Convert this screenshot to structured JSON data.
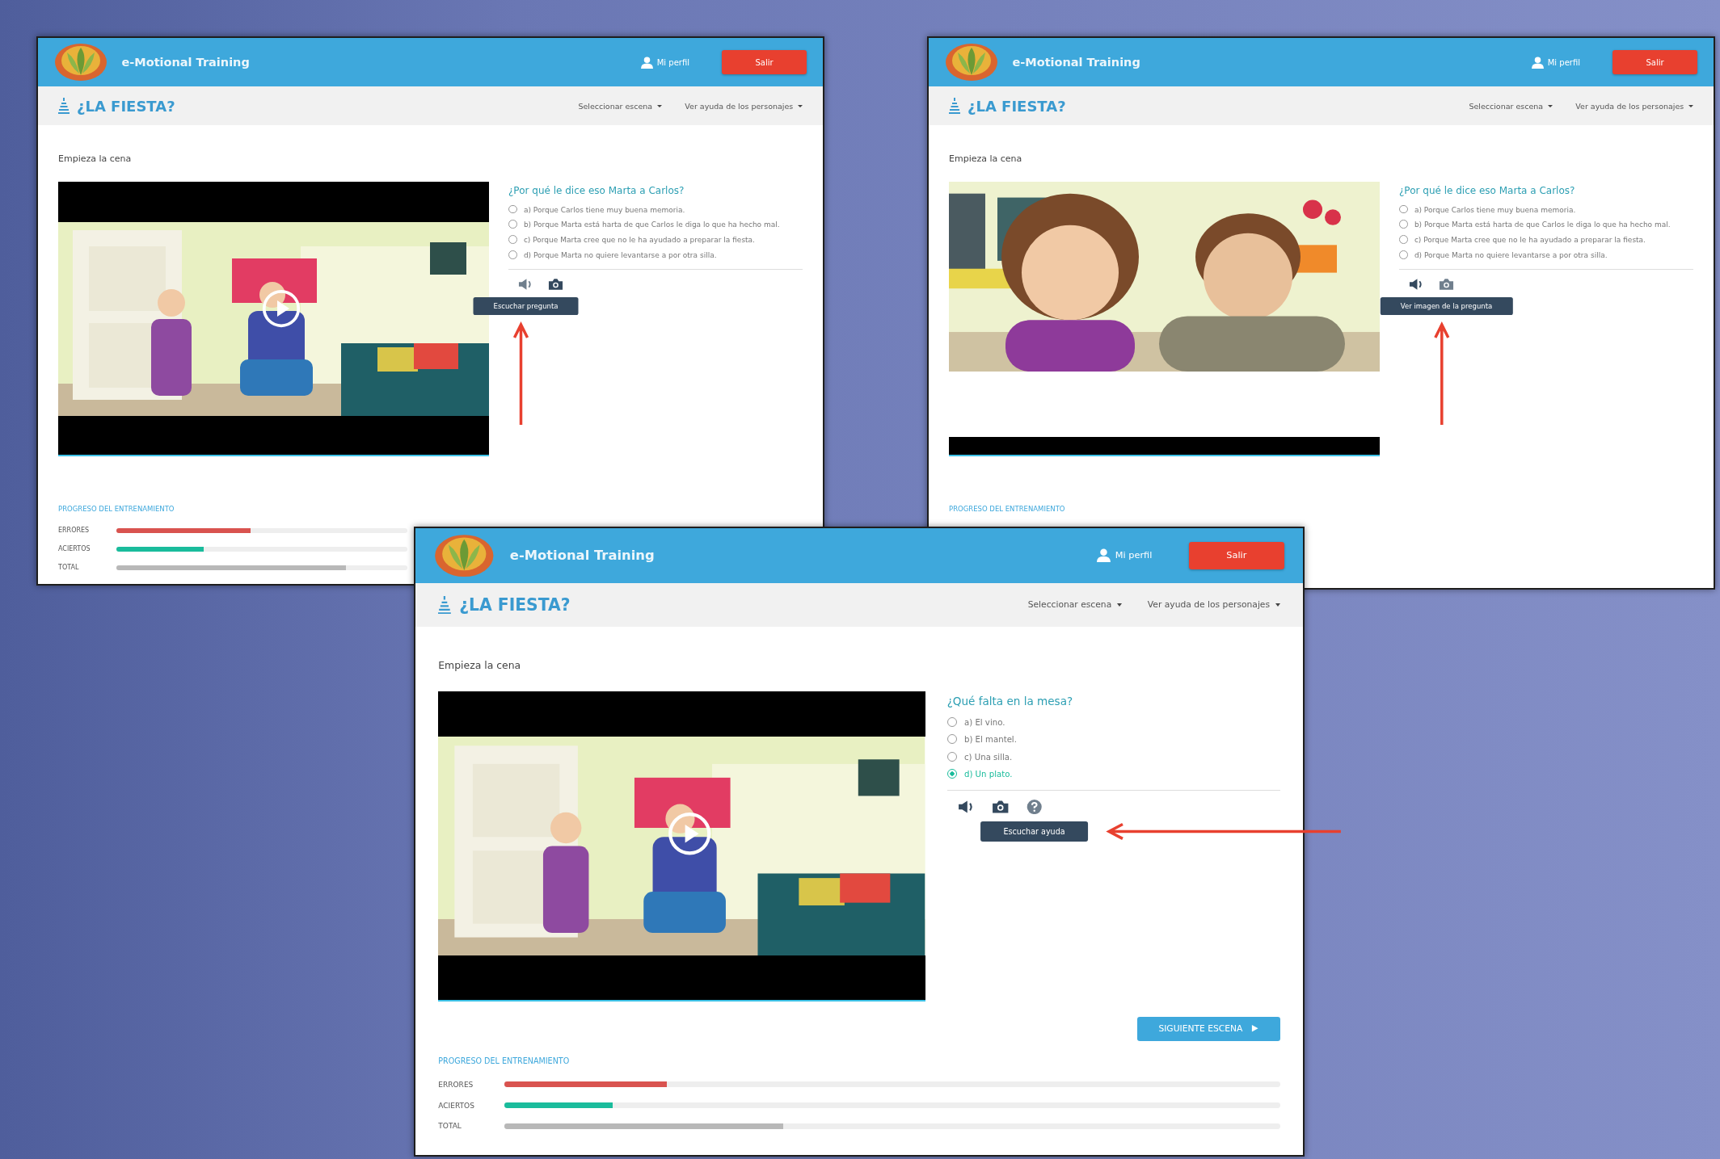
{
  "windows": [
    {
      "header": {
        "title": "e-Motional Training",
        "profile": "Mi perfil",
        "logout": "Salir"
      },
      "toolbar": {
        "title": "¿LA FIESTA?",
        "menus": [
          "Seleccionar escena",
          "Ver ayuda de los personajes"
        ]
      },
      "scene": "Empieza la cena",
      "video": {
        "kind": "letterbox",
        "play": true
      },
      "question": {
        "title": "¿Por qué le dice eso Marta a Carlos?",
        "options": [
          {
            "label": "a) Porque Carlos tiene muy buena memoria.",
            "selected": false
          },
          {
            "label": "b) Porque Marta está harta de que Carlos le diga lo que ha hecho mal.",
            "selected": false
          },
          {
            "label": "c) Porque Marta cree que no le ha ayudado a preparar la fiesta.",
            "selected": false
          },
          {
            "label": "d) Porque Marta no quiere levantarse a por otra silla.",
            "selected": false
          }
        ]
      },
      "tools": [
        {
          "kind": "speaker",
          "hovered": true
        },
        {
          "kind": "camera",
          "hovered": false
        }
      ],
      "tooltip": "Escuchar pregunta",
      "arrow": {
        "kind": "up"
      },
      "progress": {
        "title": "PROGRESO DEL ENTRENAMIENTO",
        "rows": [
          {
            "label": "ERRORES",
            "kind": "errors",
            "level": 0.46
          },
          {
            "label": "ACIERTOS",
            "kind": "hits",
            "level": 0.3
          },
          {
            "label": "TOTAL",
            "kind": "total",
            "level": 0.79
          }
        ]
      }
    },
    {
      "header": {
        "title": "e-Motional Training",
        "profile": "Mi perfil",
        "logout": "Salir"
      },
      "toolbar": {
        "title": "¿LA FIESTA?",
        "menus": [
          "Seleccionar escena",
          "Ver ayuda de los personajes"
        ]
      },
      "scene": "Empieza la cena",
      "video": {
        "kind": "closeup",
        "play": false
      },
      "question": {
        "title": "¿Por qué le dice eso Marta a Carlos?",
        "options": [
          {
            "label": "a) Porque Carlos tiene muy buena memoria.",
            "selected": false
          },
          {
            "label": "b) Porque Marta está harta de que Carlos le diga lo que ha hecho mal.",
            "selected": false
          },
          {
            "label": "c) Porque Marta cree que no le ha ayudado a preparar la fiesta.",
            "selected": false
          },
          {
            "label": "d) Porque Marta no quiere levantarse a por otra silla.",
            "selected": false
          }
        ]
      },
      "tools": [
        {
          "kind": "speaker",
          "hovered": false
        },
        {
          "kind": "camera",
          "hovered": true
        }
      ],
      "tooltip": "Ver imagen de la pregunta",
      "arrow": {
        "kind": "up"
      },
      "progress": {
        "title": "PROGRESO DEL ENTRENAMIENTO"
      }
    },
    {
      "header": {
        "title": "e-Motional Training",
        "profile": "Mi perfil",
        "logout": "Salir"
      },
      "toolbar": {
        "title": "¿LA FIESTA?",
        "menus": [
          "Seleccionar escena",
          "Ver ayuda de los personajes"
        ]
      },
      "scene": "Empieza la cena",
      "video": {
        "kind": "letterbox",
        "play": true
      },
      "question": {
        "title": "¿Qué falta en la mesa?",
        "options": [
          {
            "label": "a) El vino.",
            "selected": false
          },
          {
            "label": "b) El mantel.",
            "selected": false
          },
          {
            "label": "c) Una silla.",
            "selected": false
          },
          {
            "label": "d) Un plato.",
            "selected": true
          }
        ]
      },
      "tools": [
        {
          "kind": "speaker",
          "hovered": false
        },
        {
          "kind": "camera",
          "hovered": false
        },
        {
          "kind": "help",
          "hovered": true
        }
      ],
      "tooltip": "Escuchar ayuda",
      "arrow": {
        "kind": "left"
      },
      "next_button": "SIGUIENTE ESCENA",
      "progress": {
        "title": "PROGRESO DEL ENTRENAMIENTO",
        "rows": [
          {
            "label": "ERRORES",
            "kind": "errors",
            "level": 0.21
          },
          {
            "label": "ACIERTOS",
            "kind": "hits",
            "level": 0.14
          },
          {
            "label": "TOTAL",
            "kind": "total",
            "level": 0.36
          }
        ]
      }
    }
  ]
}
